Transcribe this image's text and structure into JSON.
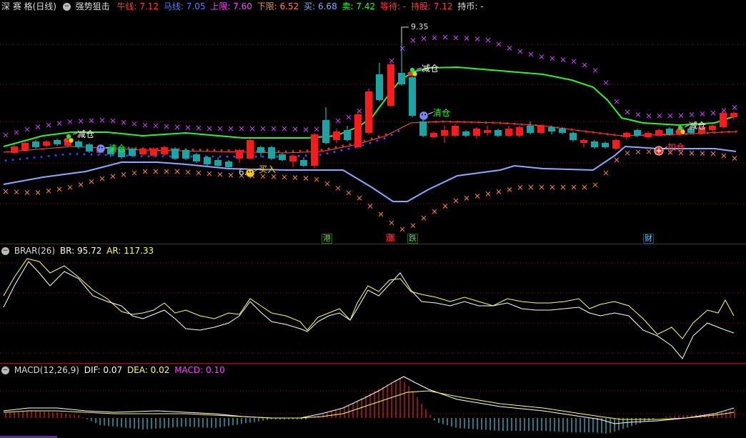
{
  "header": {
    "stock_name": "深 赛 格(日线)",
    "indicator_name": "强势狙击",
    "items": [
      {
        "label": "牛线: 7.12",
        "color": "#ff3b3b"
      },
      {
        "label": "马线: 7.05",
        "color": "#5a7cff"
      },
      {
        "label": "上限: 7.60",
        "color": "#ff44ff"
      },
      {
        "label": "下限: 6.52",
        "color": "#ff8844"
      },
      {
        "label": "买: 6.68",
        "color": "#8fa8ff"
      },
      {
        "label": "卖: 7.42",
        "color": "#33ee33"
      },
      {
        "label": "等待: -",
        "color": "#ff3b3b"
      },
      {
        "label": "持股: 7.12",
        "color": "#ff3b3b"
      },
      {
        "label": "持币: -",
        "color": "#dddddd"
      }
    ]
  },
  "main": {
    "high_label": "9.35",
    "signals": [
      {
        "text": "减仓",
        "color": "#ffffff"
      },
      {
        "text": "清仓",
        "color": "#33ee33"
      },
      {
        "text": "买入",
        "color": "#ffcc00"
      },
      {
        "text": "6.",
        "color": "#dddddd"
      },
      {
        "text": "减仓",
        "color": "#ffffff"
      },
      {
        "text": "清仓",
        "color": "#33ee33"
      },
      {
        "text": "减仓",
        "color": "#ffffff"
      },
      {
        "text": "加仓",
        "color": "#ff3b3b"
      }
    ],
    "badges": [
      {
        "text": "港",
        "color": "#33ee33"
      },
      {
        "text": "涨",
        "color": "#ff3b3b"
      },
      {
        "text": "跌",
        "color": "#33ee33"
      },
      {
        "text": "财",
        "color": "#66ccff"
      }
    ]
  },
  "brar": {
    "title": "BRAR(26)",
    "br_label": "BR: 95.72",
    "ar_label": "AR: 117.33",
    "br_color": "#ffffff",
    "ar_color": "#ffff66"
  },
  "macd": {
    "title": "MACD(12,26,9)",
    "dif_label": "DIF: 0.07",
    "dea_label": "DEA: 0.02",
    "macd_label": "MACD: 0.10",
    "dif_color": "#ffffff",
    "dea_color": "#ffff66",
    "macd_color": "#ff44ff"
  },
  "colors": {
    "up": "#ff1a1a",
    "down": "#19a5a5",
    "green_line": "#33ee33",
    "blue_line": "#8fa8ff",
    "red_line": "#ff3b3b",
    "magenta_cross": "#cc44ff",
    "orange_cross": "#ff8844",
    "grid": "#8b1a1a"
  },
  "icons": {
    "panel_toggle": "circle-minus-icon",
    "smile": "smiley-icon",
    "sad": "sad-face-icon",
    "trio": "three-ball-icon",
    "plus": "plus-circle-icon"
  }
}
